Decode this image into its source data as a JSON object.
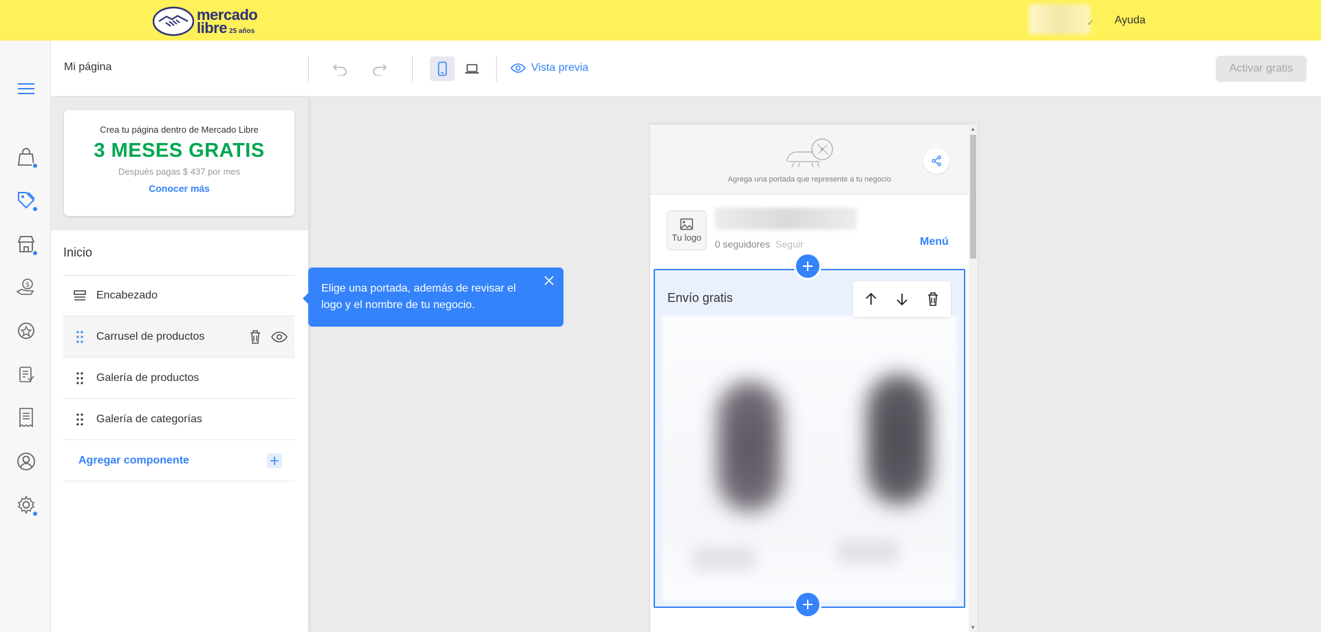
{
  "topbar": {
    "brand_line1": "mercado",
    "brand_line2": "libre",
    "brand_badge": "25 años",
    "help_label": "Ayuda",
    "brand_color": "#fff159"
  },
  "toolbar": {
    "page_name": "Mi página",
    "preview_label": "Vista previa",
    "activate_label": "Activar gratis"
  },
  "promo": {
    "subtitle": "Crea tu página dentro de Mercado Libre",
    "headline": "3 MESES GRATIS",
    "note": "Después pagas $ 437 por mes",
    "link": "Conocer más"
  },
  "sidebar": {
    "section_title": "Inicio",
    "items": [
      {
        "label": "Encabezado"
      },
      {
        "label": "Carrusel de productos"
      },
      {
        "label": "Galería de productos"
      },
      {
        "label": "Galería de categorías"
      }
    ],
    "add_component": "Agregar componente"
  },
  "tooltip": {
    "text": "Elige una portada, además de revisar el logo y el nombre de tu negocio."
  },
  "preview": {
    "cover_hint": "Agrega una portada que represente a tu negocio",
    "logo_label": "Tu logo",
    "followers": "0 seguidores",
    "follow": "Seguir",
    "menu": "Menú",
    "carousel_title": "Envío gratis"
  },
  "rail": {
    "icons": [
      "menu-icon",
      "shopping-bag-icon",
      "tag-icon",
      "store-icon",
      "hand-money-icon",
      "star-badge-icon",
      "clipboard-icon",
      "receipt-icon",
      "user-icon",
      "settings-icon"
    ]
  },
  "colors": {
    "accent": "#3483fa",
    "promo_green": "#00a650"
  }
}
